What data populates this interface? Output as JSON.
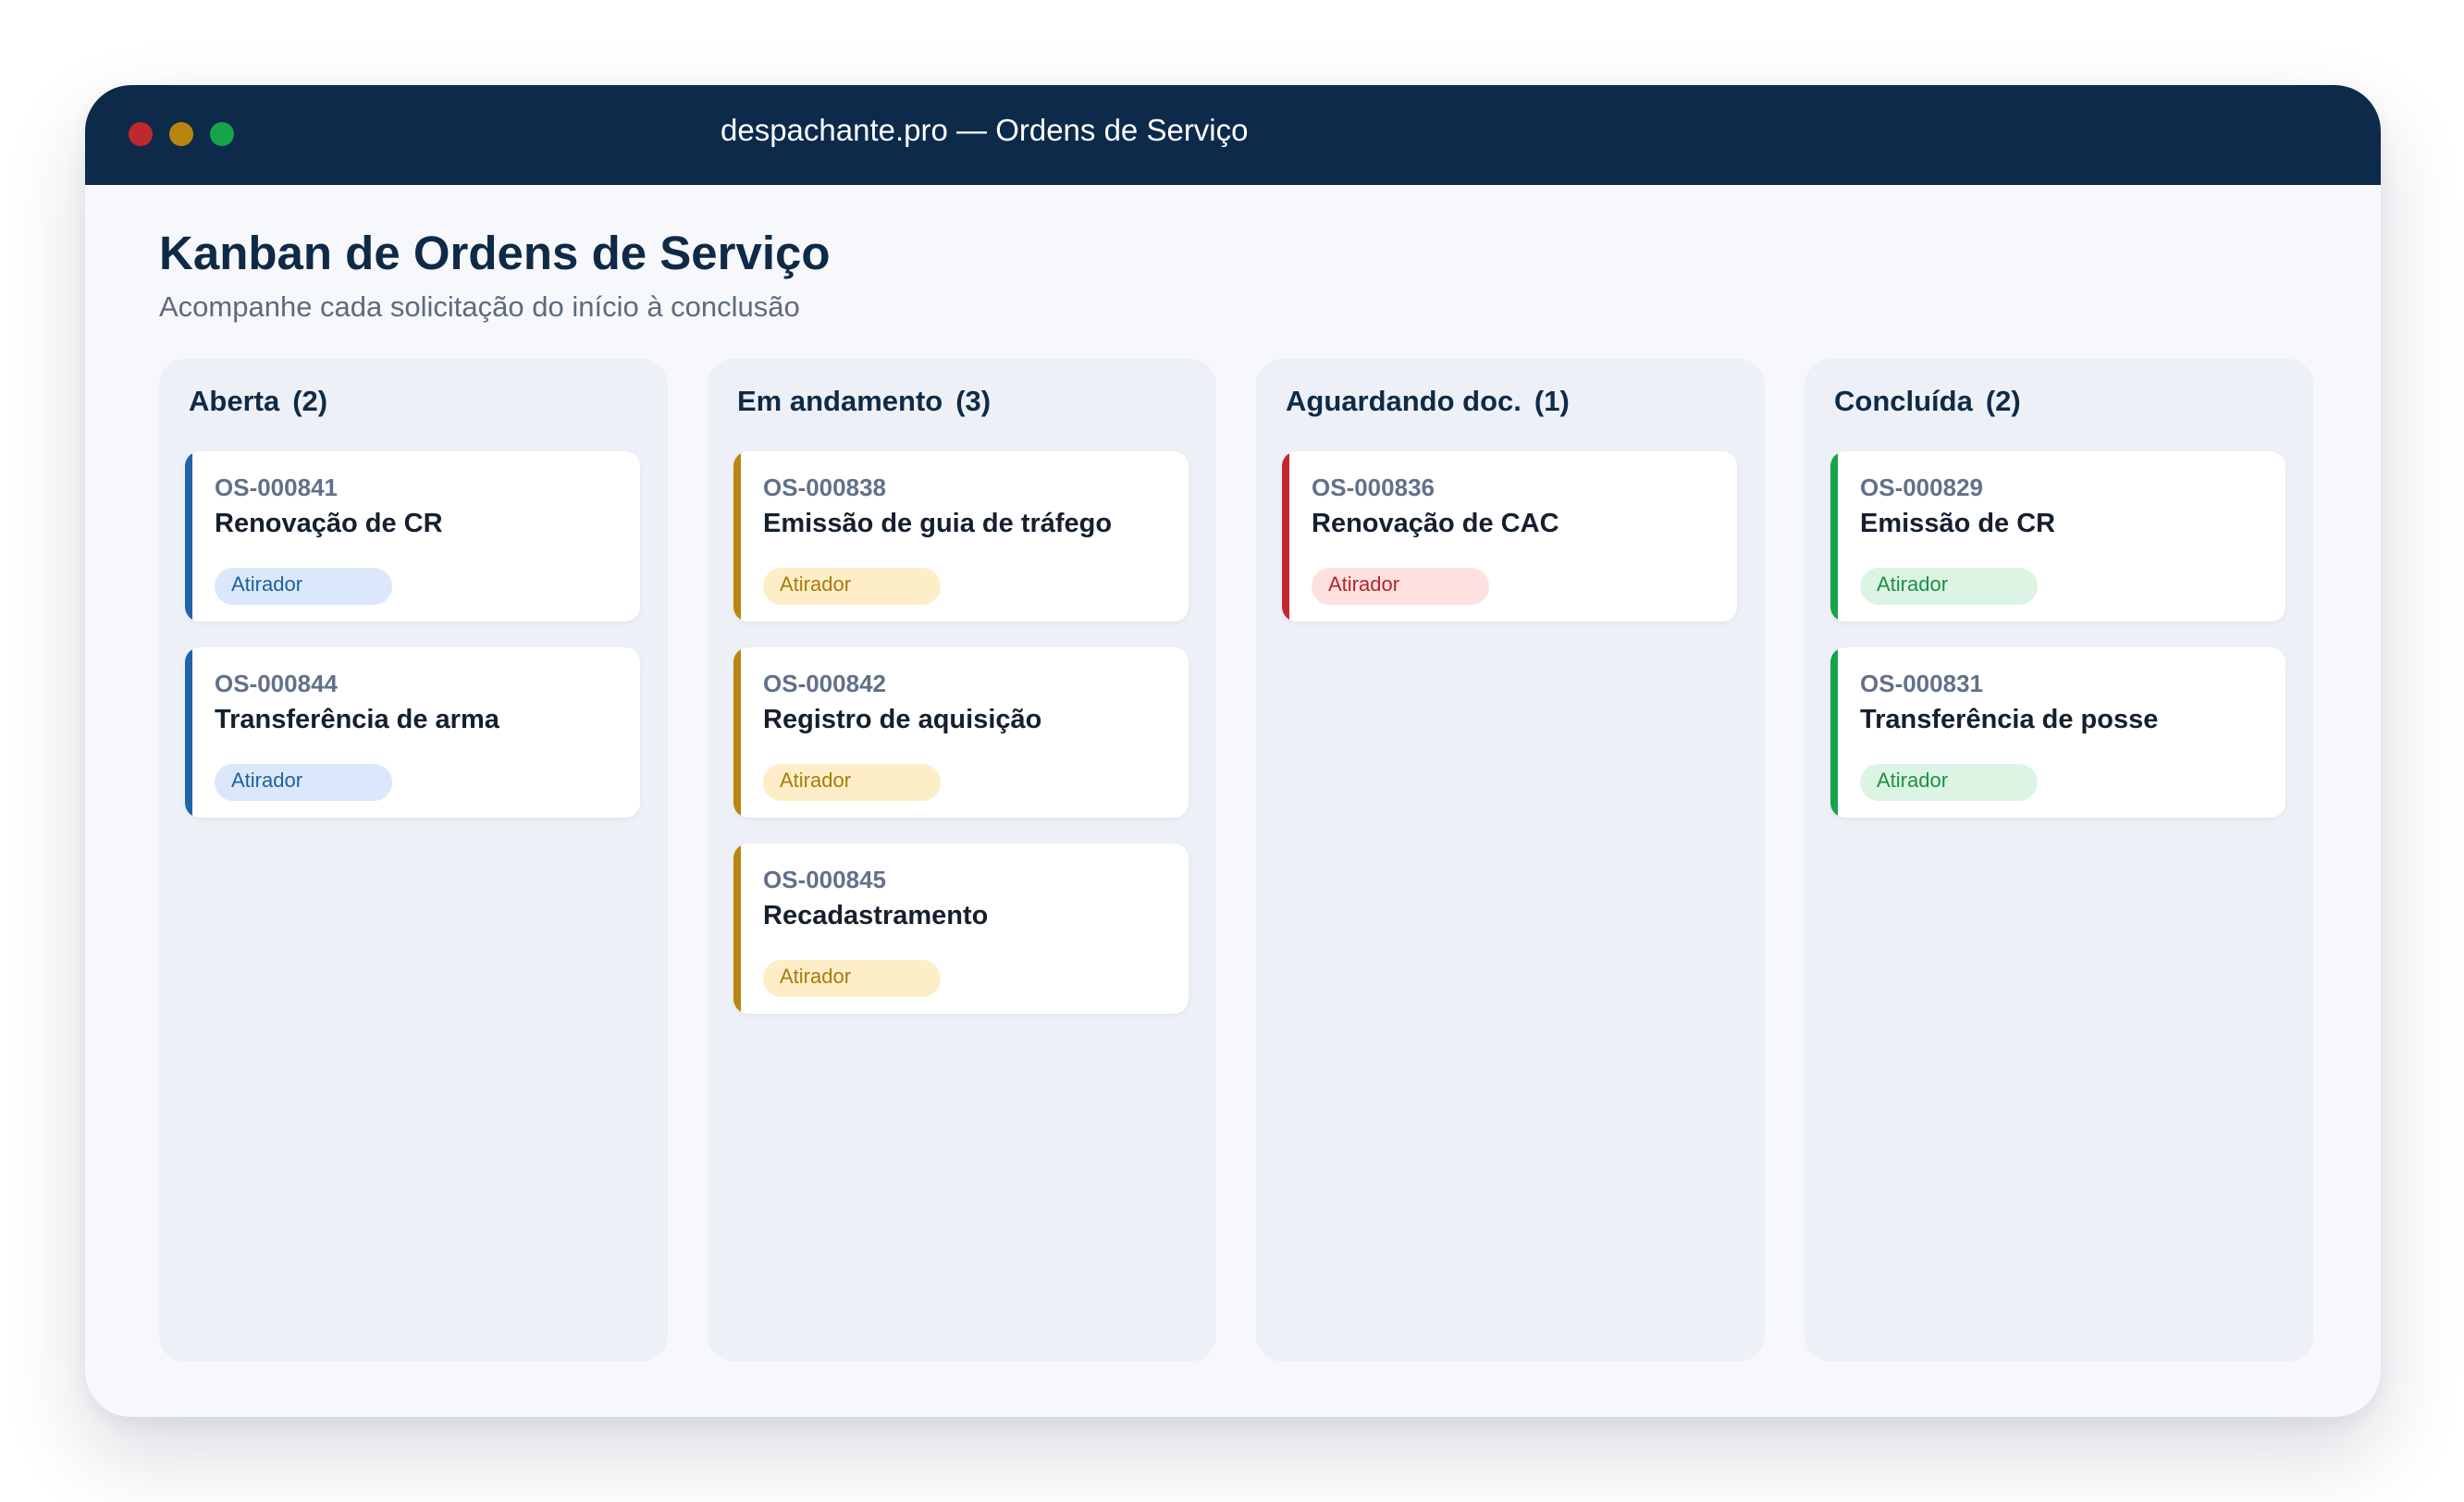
{
  "window": {
    "title": "despachante.pro — Ordens de Serviço",
    "colors": {
      "titlebar": "#0d2a4b",
      "close": "#c0282d",
      "minimize": "#b8860f",
      "maximize": "#16a34a"
    }
  },
  "page": {
    "title": "Kanban de Ordens de Serviço",
    "subtitle": "Acompanhe cada solicitação do início à conclusão"
  },
  "columns": [
    {
      "name": "Aberta",
      "count": "(2)",
      "accent": "#1f65a6",
      "tag_bg": "#dbe8fb",
      "tag_fg": "#1f5f9c",
      "cards": [
        {
          "id": "OS-000841",
          "title": "Renovação de CR",
          "tag": "Atirador"
        },
        {
          "id": "OS-000844",
          "title": "Transferência de arma",
          "tag": "Atirador"
        }
      ]
    },
    {
      "name": "Em andamento",
      "count": "(3)",
      "accent": "#b8860f",
      "tag_bg": "#fdeec7",
      "tag_fg": "#a97a0c",
      "cards": [
        {
          "id": "OS-000838",
          "title": "Emissão de guia de tráfego",
          "tag": "Atirador"
        },
        {
          "id": "OS-000842",
          "title": "Registro de aquisição",
          "tag": "Atirador"
        },
        {
          "id": "OS-000845",
          "title": "Recadastramento",
          "tag": "Atirador"
        }
      ]
    },
    {
      "name": "Aguardando doc.",
      "count": "(1)",
      "accent": "#c0282d",
      "tag_bg": "#fde0e0",
      "tag_fg": "#b3262b",
      "cards": [
        {
          "id": "OS-000836",
          "title": "Renovação de CAC",
          "tag": "Atirador"
        }
      ]
    },
    {
      "name": "Concluída",
      "count": "(2)",
      "accent": "#16a34a",
      "tag_bg": "#dcf4e3",
      "tag_fg": "#1c8f45",
      "cards": [
        {
          "id": "OS-000829",
          "title": "Emissão de CR",
          "tag": "Atirador"
        },
        {
          "id": "OS-000831",
          "title": "Transferência de posse",
          "tag": "Atirador"
        }
      ]
    }
  ]
}
